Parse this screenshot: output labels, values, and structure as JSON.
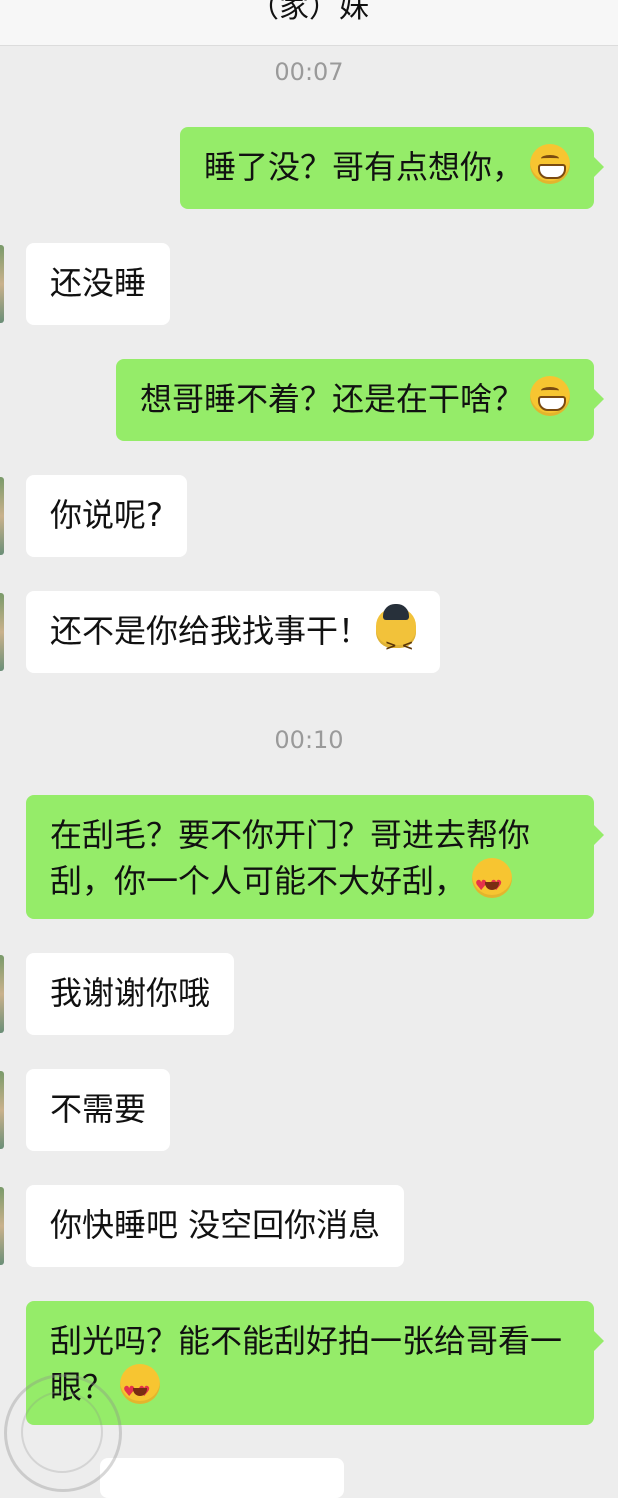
{
  "header": {
    "title": "（家）妹"
  },
  "timestamps": {
    "t1": "00:07",
    "t2": "00:10"
  },
  "messages": [
    {
      "side": "me",
      "text": "睡了没？哥有点想你，",
      "emoji": "grin-icon"
    },
    {
      "side": "them",
      "text": "还没睡"
    },
    {
      "side": "me",
      "text": "想哥睡不着？还是在干啥？",
      "emoji": "grin-icon"
    },
    {
      "side": "them",
      "text": "你说呢?"
    },
    {
      "side": "them",
      "text": "还不是你给我找事干！",
      "emoji": "angry-police-icon"
    },
    {
      "side": "me",
      "text": "在刮毛？要不你开门？哥进去帮你刮，你一个人可能不大好刮，",
      "emoji": "heart-eyes-icon"
    },
    {
      "side": "them",
      "text": "我谢谢你哦"
    },
    {
      "side": "them",
      "text": "不需要"
    },
    {
      "side": "them",
      "text": "你快睡吧 没空回你消息"
    },
    {
      "side": "me",
      "text": "刮光吗？能不能刮好拍一张给哥看一眼？",
      "emoji": "heart-eyes-icon"
    }
  ],
  "colors": {
    "background": "#ededed",
    "me_bubble": "#95ec69",
    "them_bubble": "#ffffff"
  }
}
